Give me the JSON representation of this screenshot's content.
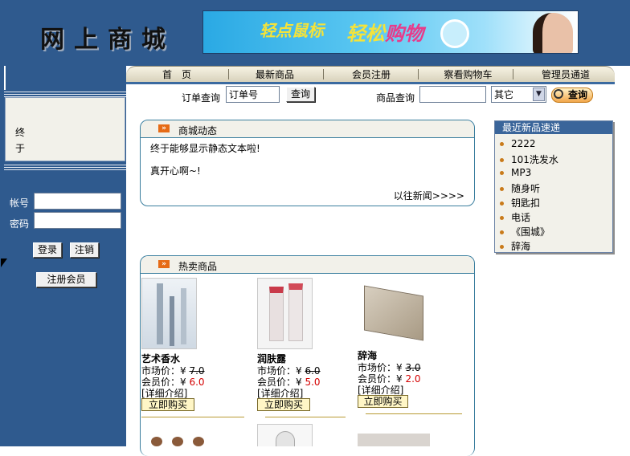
{
  "header": {
    "logo_text": "网上商城",
    "banner_text_1": "轻点鼠标",
    "banner_text_2a": "轻松",
    "banner_text_2b": "购物"
  },
  "nav": {
    "items": [
      "首　页",
      "最新商品",
      "会员注册",
      "察看购物车",
      "管理员通道"
    ]
  },
  "search": {
    "order_label": "订单查询",
    "order_value": "订单号",
    "order_button": "查询",
    "product_label": "商品查询",
    "product_value": "",
    "category_selected": "其它",
    "search_button": "查询"
  },
  "sidebar": {
    "notice_chars": [
      "终",
      "于"
    ],
    "account_label": "帐号",
    "password_label": "密码",
    "login_button": "登录",
    "logout_button": "注销",
    "register_button": "注册会员"
  },
  "news": {
    "title": "商城动态",
    "line1": "终于能够显示静态文本啦!",
    "line2": "真开心啊~!",
    "more_link": "以往新闻>>>>"
  },
  "new_products": {
    "title": "最近新品速递",
    "items": [
      "2222",
      "101洗发水",
      "MP3",
      "随身听",
      "钥匙扣",
      "电话",
      "《围城》",
      "辞海"
    ]
  },
  "hot": {
    "title": "热卖商品",
    "products": [
      {
        "name": "艺术香水",
        "market_label": "市场价：¥",
        "market_price": "7.0",
        "member_label": "会员价：¥",
        "member_price": "6.0",
        "detail": "[详细介绍]",
        "buy": "立即购买"
      },
      {
        "name": "润肤露",
        "market_label": "市场价：¥",
        "market_price": "6.0",
        "member_label": "会员价：¥",
        "member_price": "5.0",
        "detail": "[详细介绍]",
        "buy": "立即购买"
      },
      {
        "name": "辞海",
        "market_label": "市场价：¥",
        "market_price": "3.0",
        "member_label": "会员价：¥",
        "member_price": "2.0",
        "detail": "[详细介绍]",
        "buy": "立即购买"
      }
    ]
  },
  "colors": {
    "primary": "#2f5a8e",
    "panel_bg": "#f2f1ea",
    "accent": "#e66b16",
    "price_red": "#d40000"
  },
  "icons": {
    "news_icon": "double-chevron-right-icon",
    "hot_icon": "double-chevron-right-icon",
    "bullet": "dot-icon",
    "search_go_icon": "magnifier-icon"
  }
}
